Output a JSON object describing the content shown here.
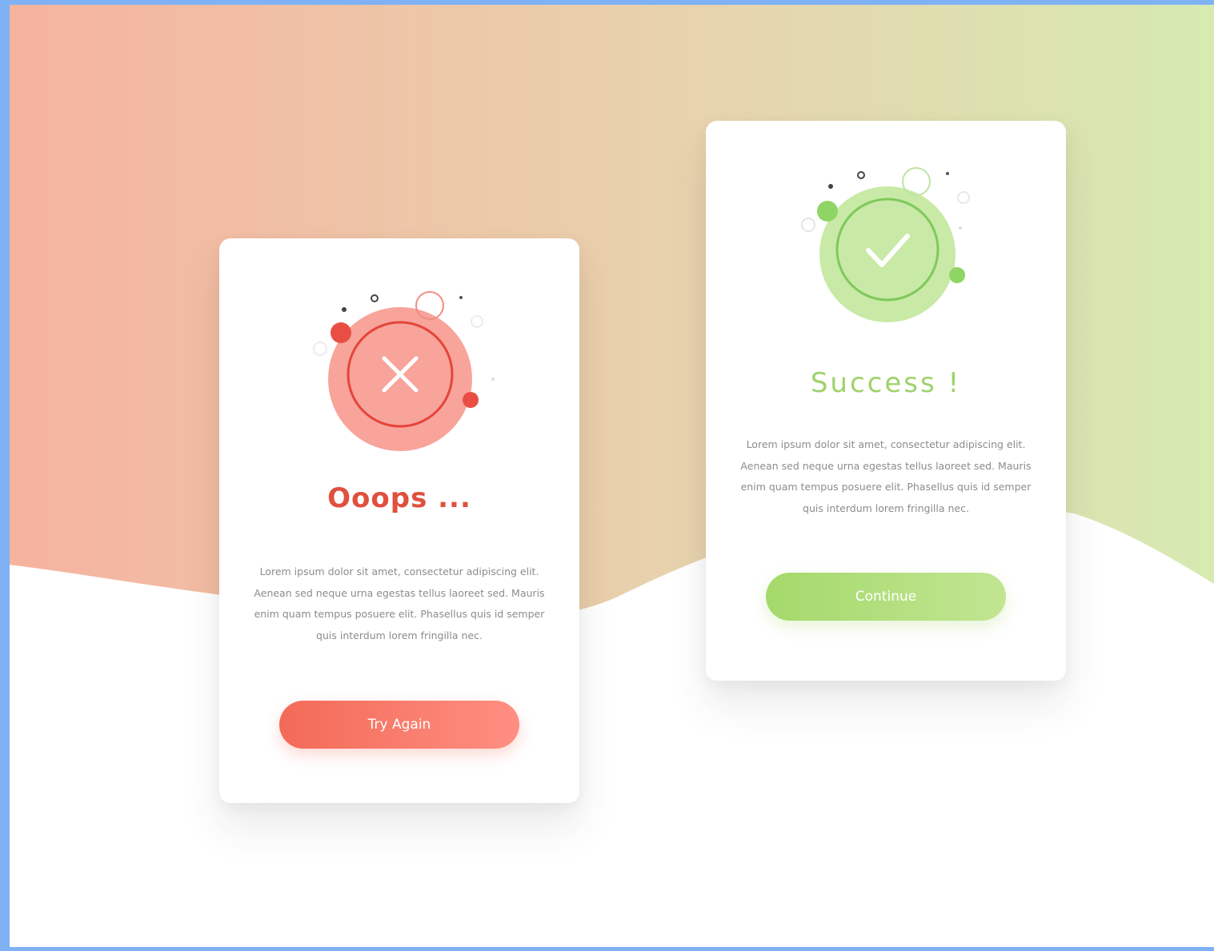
{
  "error_card": {
    "title": "Ooops ...",
    "body": "Lorem ipsum dolor sit amet, consectetur adipiscing elit. Aenean sed neque urna egestas tellus laoreet sed. Mauris enim quam tempus posuere elit. Phasellus quis id semper quis interdum lorem fringilla nec.",
    "button_label": "Try Again",
    "icon": "close-icon",
    "accent_color": "#e0503e"
  },
  "success_card": {
    "title": "Success !",
    "body": "Lorem ipsum dolor sit amet, consectetur adipiscing elit. Aenean sed neque urna egestas tellus laoreet sed. Mauris enim quam tempus posuere elit. Phasellus quis id semper quis interdum lorem fringilla nec.",
    "button_label": "Continue",
    "icon": "check-icon",
    "accent_color": "#9fd26b"
  },
  "colors": {
    "page_border": "#7fb2f5",
    "background_gradient_start": "#f6b3a0",
    "background_gradient_end": "#d6eab2",
    "error_button": "#f36a57",
    "success_button": "#a4d96b"
  }
}
